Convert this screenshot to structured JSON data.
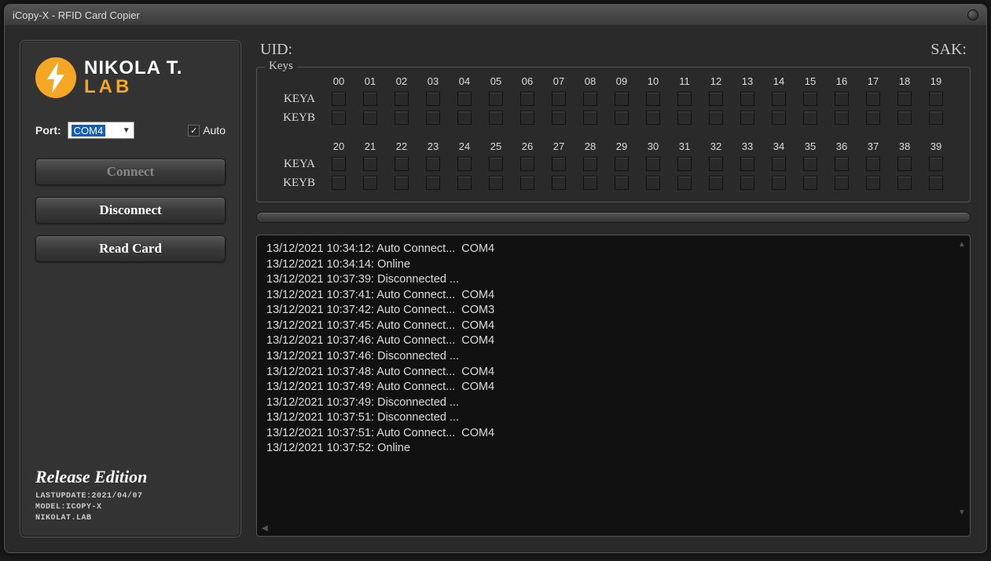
{
  "window": {
    "title": "iCopy-X - RFID Card Copier"
  },
  "logo": {
    "line1": "NIKOLA T.",
    "line2": "LAB"
  },
  "port": {
    "label": "Port:",
    "value": "COM4",
    "auto_label": "Auto",
    "auto_checked": true
  },
  "buttons": {
    "connect": "Connect",
    "disconnect": "Disconnect",
    "read_card": "Read Card"
  },
  "edition": {
    "title": "Release Edition",
    "lastupdate": "LASTUPDATE:2021/04/07",
    "model": "MODEL:ICOPY-X",
    "brand": "NIKOLAT.LAB"
  },
  "info": {
    "uid_label": "UID:",
    "uid_value": "",
    "sak_label": "SAK:",
    "sak_value": ""
  },
  "keys": {
    "legend": "Keys",
    "row_labels": [
      "KEYA",
      "KEYB"
    ],
    "cols1": [
      "00",
      "01",
      "02",
      "03",
      "04",
      "05",
      "06",
      "07",
      "08",
      "09",
      "10",
      "11",
      "12",
      "13",
      "14",
      "15",
      "16",
      "17",
      "18",
      "19"
    ],
    "cols2": [
      "20",
      "21",
      "22",
      "23",
      "24",
      "25",
      "26",
      "27",
      "28",
      "29",
      "30",
      "31",
      "32",
      "33",
      "34",
      "35",
      "36",
      "37",
      "38",
      "39"
    ]
  },
  "log": [
    "13/12/2021 10:34:12: Auto Connect...  COM4",
    "13/12/2021 10:34:14: Online",
    "13/12/2021 10:37:39: Disconnected ...",
    "13/12/2021 10:37:41: Auto Connect...  COM4",
    "13/12/2021 10:37:42: Auto Connect...  COM3",
    "13/12/2021 10:37:45: Auto Connect...  COM4",
    "13/12/2021 10:37:46: Auto Connect...  COM4",
    "13/12/2021 10:37:46: Disconnected ...",
    "13/12/2021 10:37:48: Auto Connect...  COM4",
    "13/12/2021 10:37:49: Auto Connect...  COM4",
    "13/12/2021 10:37:49: Disconnected ...",
    "13/12/2021 10:37:51: Disconnected ...",
    "13/12/2021 10:37:51: Auto Connect...  COM4",
    "13/12/2021 10:37:52: Online"
  ]
}
